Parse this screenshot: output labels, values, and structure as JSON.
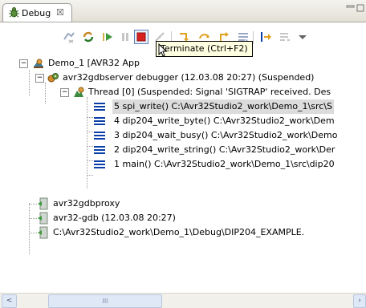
{
  "view": {
    "tab_label": "Debug",
    "tab_close": "☒"
  },
  "toolbar": {
    "tooltip": "Terminate (Ctrl+F2)"
  },
  "tree": {
    "root": "Demo_1 [AVR32 App",
    "server": "avr32gdbserver debugger (12.03.08 20:27) (Suspended)",
    "thread": "Thread [0] (Suspended: Signal 'SIGTRAP' received. Des",
    "frames": [
      "5 spi_write() C:\\Avr32Studio2_work\\Demo_1\\src\\S",
      "4 dip204_write_byte() C:\\Avr32Studio2_work\\Dem",
      "3 dip204_wait_busy() C:\\Avr32Studio2_work\\Demo",
      "2 dip204_write_string() C:\\Avr32Studio2_work\\Der",
      "1 main() C:\\Avr32Studio2_work\\Demo_1\\src\\dip20"
    ],
    "proxy": "avr32gdbproxy",
    "gdb": "avr32-gdb (12.03.08 20:27)",
    "exe": "C:\\Avr32Studio2_work\\Demo_1\\Debug\\DIP204_EXAMPLE."
  },
  "scrollbar": {
    "left_arrow": "<",
    "grip": "III"
  },
  "colors": {
    "accent": "#0b3fa8",
    "terminate": "#d92020",
    "selection": "#dcdcdc"
  }
}
